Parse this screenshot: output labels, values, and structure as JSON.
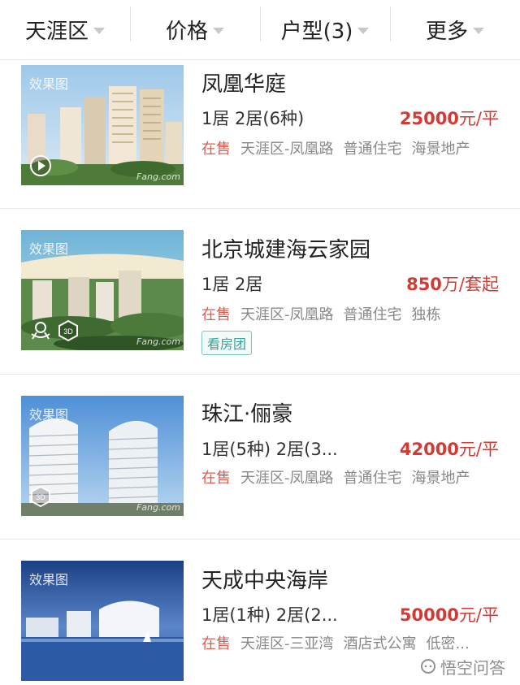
{
  "filters": [
    {
      "label": "天涯区"
    },
    {
      "label": "价格"
    },
    {
      "label": "户型(3)"
    },
    {
      "label": "更多"
    }
  ],
  "listings": [
    {
      "image_tag": "效果图",
      "watermark": "Fang.com",
      "title": "凤凰华庭",
      "rooms": "1居 2居(6种)",
      "price_value": "25000",
      "price_unit": "元/平",
      "status": "在售",
      "meta": [
        "天涯区-凤凰路",
        "普通住宅",
        "海景地产"
      ],
      "badge": "",
      "overlay_icons": [
        "play-icon"
      ]
    },
    {
      "image_tag": "效果图",
      "watermark": "Fang.com",
      "title": "北京城建海云家园",
      "rooms": "1居 2居",
      "price_value": "850",
      "price_unit": "万/套起",
      "status": "在售",
      "meta": [
        "天涯区-凤凰路",
        "普通住宅",
        "独栋"
      ],
      "badge": "看房团",
      "overlay_icons": [
        "vr-icon",
        "3d-icon"
      ]
    },
    {
      "image_tag": "效果图",
      "watermark": "Fang.com",
      "title": "珠江·俪豪",
      "rooms": "1居(5种) 2居(3...",
      "price_value": "42000",
      "price_unit": "元/平",
      "status": "在售",
      "meta": [
        "天涯区-凤凰路",
        "普通住宅",
        "海景地产"
      ],
      "badge": "",
      "overlay_icons": [
        "3d-icon"
      ]
    },
    {
      "image_tag": "效果图",
      "watermark": "",
      "title": "天成中央海岸",
      "rooms": "1居(1种) 2居(2...",
      "price_value": "50000",
      "price_unit": "元/平",
      "status": "在售",
      "meta": [
        "天涯区-三亚湾",
        "酒店式公寓",
        "低密..."
      ],
      "badge": "",
      "overlay_icons": []
    }
  ],
  "footer_watermark": "悟空问答"
}
